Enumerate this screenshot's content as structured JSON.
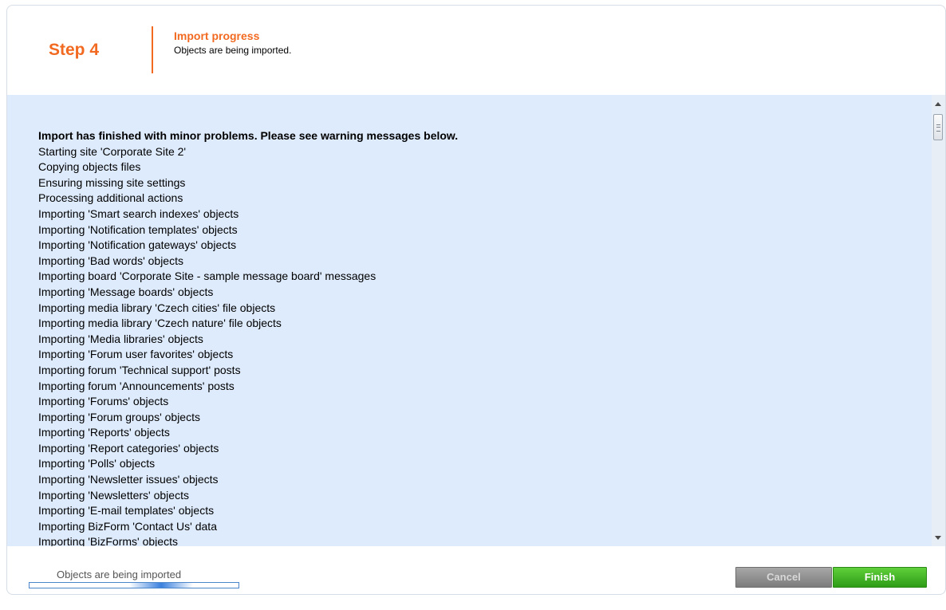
{
  "header": {
    "step_label": "Step 4",
    "title": "Import progress",
    "description": "Objects are being imported."
  },
  "log": {
    "lines": [
      "Import has finished with minor problems. Please see warning messages below.",
      "Starting site 'Corporate Site 2'",
      "Copying objects files",
      "Ensuring missing site settings",
      "Processing additional actions",
      "Importing 'Smart search indexes' objects",
      "Importing 'Notification templates' objects",
      "Importing 'Notification gateways' objects",
      "Importing 'Bad words' objects",
      "Importing board 'Corporate Site - sample message board' messages",
      "Importing 'Message boards' objects",
      "Importing media library 'Czech cities' file objects",
      "Importing media library 'Czech nature' file objects",
      "Importing 'Media libraries' objects",
      "Importing 'Forum user favorites' objects",
      "Importing forum 'Technical support' posts",
      "Importing forum 'Announcements' posts",
      "Importing 'Forums' objects",
      "Importing 'Forum groups' objects",
      "Importing 'Reports' objects",
      "Importing 'Report categories' objects",
      "Importing 'Polls' objects",
      "Importing 'Newsletter issues' objects",
      "Importing 'Newsletters' objects",
      "Importing 'E-mail templates' objects",
      "Importing BizForm 'Contact Us' data",
      "Importing 'BizForms' objects"
    ]
  },
  "footer": {
    "progress_text": "Objects are being imported",
    "cancel_label": "Cancel",
    "finish_label": "Finish"
  },
  "colors": {
    "accent": "#f26a21",
    "log_background": "#deebfd",
    "finish_button": "#3fb022",
    "cancel_button": "#8c8c8c",
    "progress": "#3a80de"
  },
  "icons": {
    "scroll_up": "triangle-up",
    "scroll_down": "triangle-down",
    "scroll_thumb_grip": "grip-lines"
  }
}
